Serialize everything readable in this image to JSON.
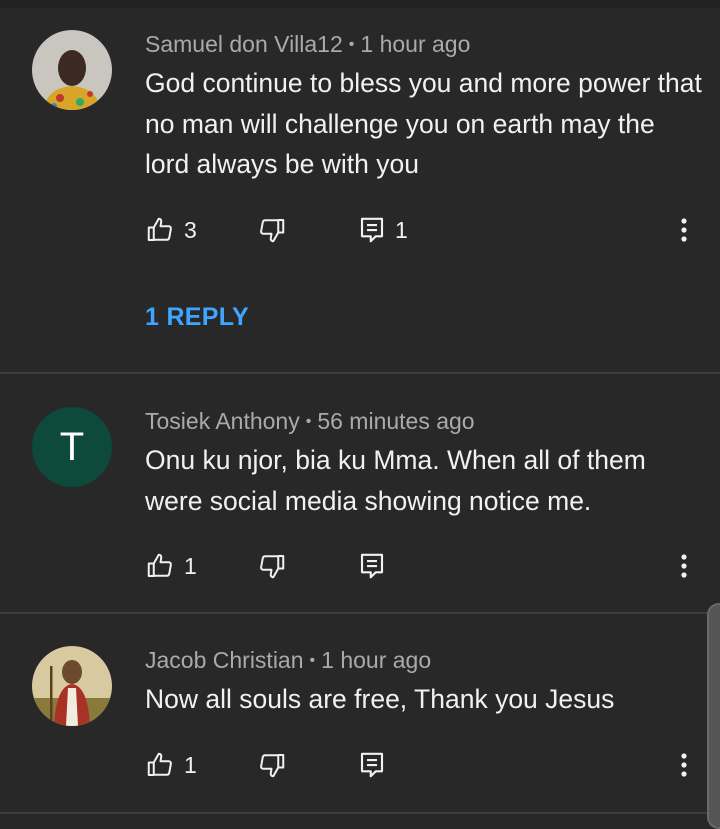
{
  "colors": {
    "background": "#282828",
    "text_primary": "#f1f1f1",
    "text_secondary": "#aaaaaa",
    "link": "#3ea6ff",
    "avatar_t_bg": "#0d4a3c"
  },
  "comments": [
    {
      "author": "Samuel don Villa12",
      "separator": "•",
      "time": "1 hour ago",
      "text": "God continue to bless you and more power that no man will challenge you on earth may the lord always be with you",
      "likes": "3",
      "replies_count": "1",
      "reply_link": "1 REPLY",
      "avatar": "photo-avatar"
    },
    {
      "author": "Tosiek Anthony",
      "separator": "•",
      "time": "56 minutes ago",
      "text": "Onu ku njor, bia ku Mma. When all of them were social media showing notice me.",
      "likes": "1",
      "avatar_letter": "T"
    },
    {
      "author": "Jacob Christian",
      "separator": "•",
      "time": "1 hour ago",
      "text": "Now all souls are free, Thank you Jesus",
      "likes": "1",
      "avatar": "photo-avatar"
    }
  ],
  "icons": {
    "like": "thumbs-up-icon",
    "dislike": "thumbs-down-icon",
    "reply": "comment-icon",
    "more": "more-vert-icon"
  }
}
